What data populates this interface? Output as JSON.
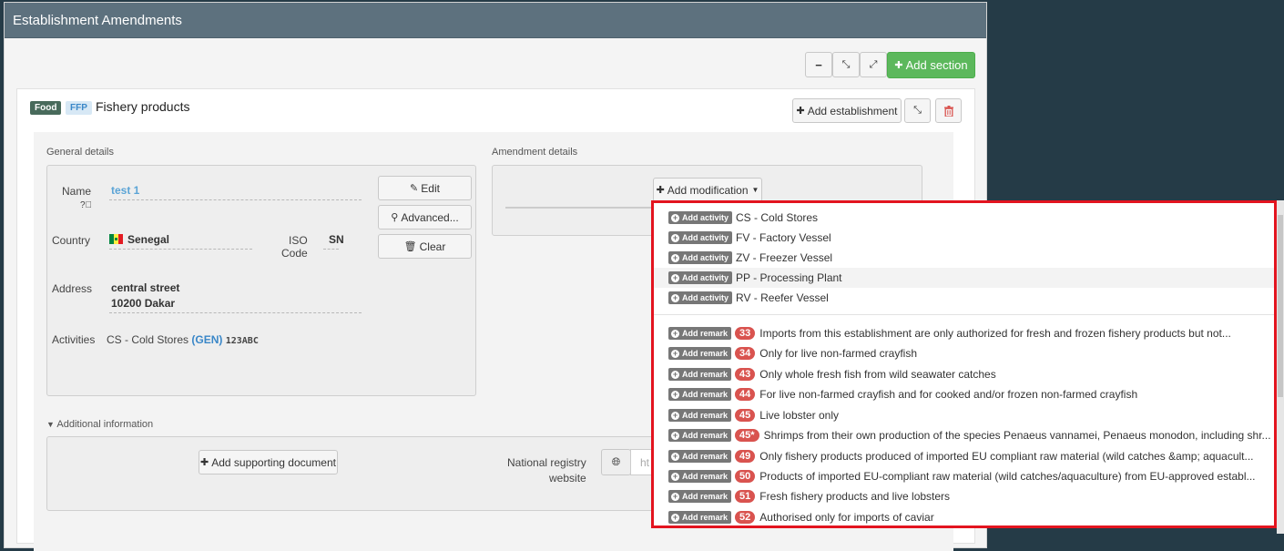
{
  "panel": {
    "title": "Establishment Amendments"
  },
  "toolbar": {
    "collapse_all": "−",
    "compress": "⤡",
    "expand": "⤢",
    "add_section": "Add section"
  },
  "section": {
    "badge_food": "Food",
    "badge_ffp": "FFP",
    "title": "Fishery products",
    "add_establishment": "Add establishment"
  },
  "general": {
    "label": "General details",
    "name_label": "Name",
    "name_value": "test 1",
    "country_label": "Country",
    "country_value": "Senegal",
    "iso_label_1": "ISO",
    "iso_label_2": "Code",
    "iso_value": "SN",
    "address_label": "Address",
    "address_line1": "central street",
    "address_line2": "10200 Dakar",
    "activities_label": "Activities",
    "activity_name": "CS - Cold Stores",
    "activity_gen": "(GEN)",
    "activity_code": "123ABC",
    "edit_btn": "Edit",
    "advanced_btn": "Advanced...",
    "clear_btn": "Clear"
  },
  "amendment": {
    "label": "Amendment details",
    "add_modification": "Add modification"
  },
  "additional": {
    "label": "Additional information",
    "add_doc": "Add supporting document",
    "registry_label_1": "National registry",
    "registry_label_2": "website",
    "url_placeholder": "ht"
  },
  "menu": {
    "activity_tag": "Add activity",
    "remark_tag": "Add remark",
    "activities": [
      {
        "text": "CS - Cold Stores"
      },
      {
        "text": "FV - Factory Vessel"
      },
      {
        "text": "ZV - Freezer Vessel"
      },
      {
        "text": "PP - Processing Plant"
      },
      {
        "text": "RV - Reefer Vessel"
      }
    ],
    "remarks": [
      {
        "num": "33",
        "text": "Imports from this establishment are only authorized for fresh and frozen fishery products but not..."
      },
      {
        "num": "34",
        "text": "Only for live non-farmed crayfish"
      },
      {
        "num": "43",
        "text": "Only whole fresh fish from wild seawater catches"
      },
      {
        "num": "44",
        "text": "For live non-farmed crayfish and for cooked and/or frozen non-farmed crayfish"
      },
      {
        "num": "45",
        "text": "Live lobster only"
      },
      {
        "num": "45*",
        "text": "Shrimps from their own production of the species Penaeus vannamei, Penaeus monodon, including shr..."
      },
      {
        "num": "49",
        "text": "Only fishery products produced of imported EU compliant raw material (wild catches &amp; aquacult..."
      },
      {
        "num": "50",
        "text": "Products of imported EU-compliant raw material (wild catches/aquaculture) from EU-approved establ..."
      },
      {
        "num": "51",
        "text": "Fresh fishery products and live lobsters"
      },
      {
        "num": "52",
        "text": "Authorised only for imports of caviar"
      }
    ]
  }
}
